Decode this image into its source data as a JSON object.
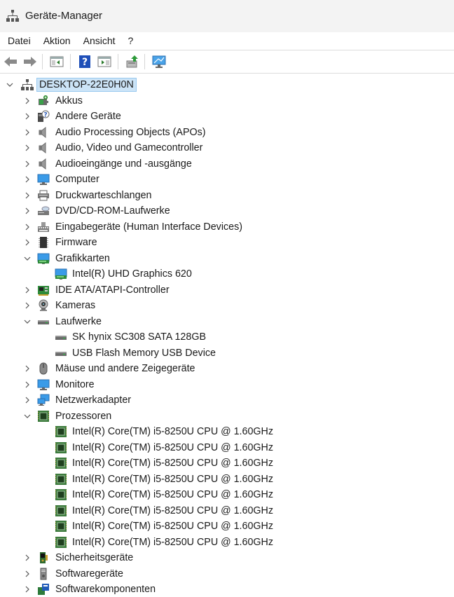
{
  "window": {
    "title": "Geräte-Manager"
  },
  "menu": [
    "Datei",
    "Aktion",
    "Ansicht",
    "?"
  ],
  "toolbar": [
    {
      "name": "back-button",
      "icon": "arrow-left-icon"
    },
    {
      "name": "forward-button",
      "icon": "arrow-right-icon"
    },
    {
      "name": "show-hide-console-tree-button",
      "icon": "console-tree-icon"
    },
    {
      "name": "help-button",
      "icon": "help-icon"
    },
    {
      "name": "show-hide-action-pane-button",
      "icon": "action-pane-icon"
    },
    {
      "name": "update-driver-button",
      "icon": "update-driver-icon"
    },
    {
      "name": "scan-hardware-button",
      "icon": "monitor-scan-icon"
    }
  ],
  "tree": {
    "root": "DESKTOP-22E0H0N",
    "nodes": [
      {
        "label": "Akkus",
        "icon": "battery-icon",
        "state": "collapsed",
        "level": 1
      },
      {
        "label": "Andere Geräte",
        "icon": "unknown-device-icon",
        "state": "collapsed",
        "level": 1
      },
      {
        "label": "Audio Processing Objects (APOs)",
        "icon": "speaker-icon",
        "state": "collapsed",
        "level": 1
      },
      {
        "label": "Audio, Video und Gamecontroller",
        "icon": "speaker-icon",
        "state": "collapsed",
        "level": 1
      },
      {
        "label": "Audioeingänge und -ausgänge",
        "icon": "speaker-icon",
        "state": "collapsed",
        "level": 1
      },
      {
        "label": "Computer",
        "icon": "computer-icon",
        "state": "collapsed",
        "level": 1
      },
      {
        "label": "Druckwarteschlangen",
        "icon": "printer-icon",
        "state": "collapsed",
        "level": 1
      },
      {
        "label": "DVD/CD-ROM-Laufwerke",
        "icon": "dvd-drive-icon",
        "state": "collapsed",
        "level": 1
      },
      {
        "label": "Eingabegeräte (Human Interface Devices)",
        "icon": "hid-icon",
        "state": "collapsed",
        "level": 1
      },
      {
        "label": "Firmware",
        "icon": "firmware-icon",
        "state": "collapsed",
        "level": 1
      },
      {
        "label": "Grafikkarten",
        "icon": "display-adapter-icon",
        "state": "expanded",
        "level": 1
      },
      {
        "label": "Intel(R) UHD Graphics 620",
        "icon": "display-adapter-icon",
        "state": "leaf",
        "level": 2
      },
      {
        "label": "IDE ATA/ATAPI-Controller",
        "icon": "ide-controller-icon",
        "state": "collapsed",
        "level": 1
      },
      {
        "label": "Kameras",
        "icon": "camera-icon",
        "state": "collapsed",
        "level": 1
      },
      {
        "label": "Laufwerke",
        "icon": "disk-drive-icon",
        "state": "expanded",
        "level": 1
      },
      {
        "label": "SK hynix SC308 SATA 128GB",
        "icon": "disk-drive-icon",
        "state": "leaf",
        "level": 2
      },
      {
        "label": "USB Flash Memory USB Device",
        "icon": "disk-drive-icon",
        "state": "leaf",
        "level": 2
      },
      {
        "label": "Mäuse und andere Zeigegeräte",
        "icon": "mouse-icon",
        "state": "collapsed",
        "level": 1
      },
      {
        "label": "Monitore",
        "icon": "monitor-icon",
        "state": "collapsed",
        "level": 1
      },
      {
        "label": "Netzwerkadapter",
        "icon": "network-adapter-icon",
        "state": "collapsed",
        "level": 1
      },
      {
        "label": "Prozessoren",
        "icon": "processor-icon",
        "state": "expanded",
        "level": 1
      },
      {
        "label": "Intel(R) Core(TM) i5-8250U CPU @ 1.60GHz",
        "icon": "processor-icon",
        "state": "leaf",
        "level": 2
      },
      {
        "label": "Intel(R) Core(TM) i5-8250U CPU @ 1.60GHz",
        "icon": "processor-icon",
        "state": "leaf",
        "level": 2
      },
      {
        "label": "Intel(R) Core(TM) i5-8250U CPU @ 1.60GHz",
        "icon": "processor-icon",
        "state": "leaf",
        "level": 2
      },
      {
        "label": "Intel(R) Core(TM) i5-8250U CPU @ 1.60GHz",
        "icon": "processor-icon",
        "state": "leaf",
        "level": 2
      },
      {
        "label": "Intel(R) Core(TM) i5-8250U CPU @ 1.60GHz",
        "icon": "processor-icon",
        "state": "leaf",
        "level": 2
      },
      {
        "label": "Intel(R) Core(TM) i5-8250U CPU @ 1.60GHz",
        "icon": "processor-icon",
        "state": "leaf",
        "level": 2
      },
      {
        "label": "Intel(R) Core(TM) i5-8250U CPU @ 1.60GHz",
        "icon": "processor-icon",
        "state": "leaf",
        "level": 2
      },
      {
        "label": "Intel(R) Core(TM) i5-8250U CPU @ 1.60GHz",
        "icon": "processor-icon",
        "state": "leaf",
        "level": 2
      },
      {
        "label": "Sicherheitsgeräte",
        "icon": "security-device-icon",
        "state": "collapsed",
        "level": 1
      },
      {
        "label": "Softwaregeräte",
        "icon": "software-device-icon",
        "state": "collapsed",
        "level": 1
      },
      {
        "label": "Softwarekomponenten",
        "icon": "software-component-icon",
        "state": "collapsed",
        "level": 1
      }
    ]
  },
  "colors": {
    "selection": "#cce4f7",
    "selection_border": "#99c9ef",
    "chip_green": "#3c7a3c",
    "monitor_blue": "#2b7fd6"
  }
}
